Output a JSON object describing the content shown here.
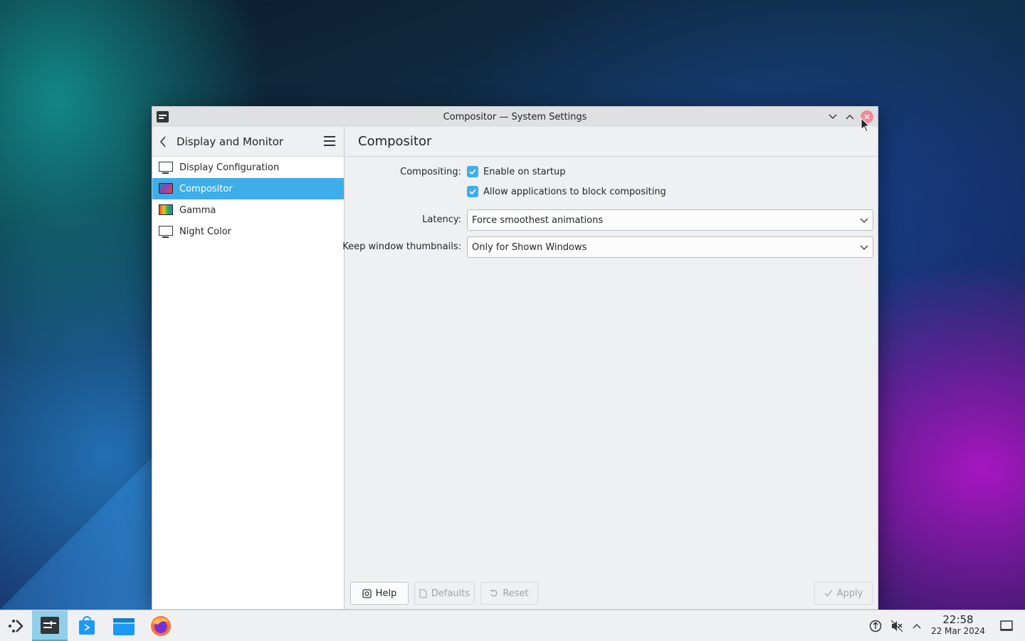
{
  "window": {
    "title": "Compositor — System Settings"
  },
  "sidebar": {
    "header": "Display and Monitor",
    "items": [
      {
        "label": "Display Configuration",
        "icon": "monitor-icon",
        "active": false
      },
      {
        "label": "Compositor",
        "icon": "compositor-icon",
        "active": true
      },
      {
        "label": "Gamma",
        "icon": "gamma-icon",
        "active": false
      },
      {
        "label": "Night Color",
        "icon": "monitor-icon",
        "active": false
      }
    ]
  },
  "main": {
    "title": "Compositor",
    "compositing_label": "Compositing:",
    "enable_on_startup": {
      "label": "Enable on startup",
      "checked": true
    },
    "allow_block": {
      "label": "Allow applications to block compositing",
      "checked": true
    },
    "latency_label": "Latency:",
    "latency_value": "Force smoothest animations",
    "thumbnails_label": "Keep window thumbnails:",
    "thumbnails_value": "Only for Shown Windows"
  },
  "buttons": {
    "help": "Help",
    "defaults": "Defaults",
    "reset": "Reset",
    "apply": "Apply"
  },
  "taskbar": {
    "time": "22:58",
    "date": "22 Mar 2024"
  },
  "colors": {
    "accent": "#3daee9",
    "window_bg": "#eff0f1",
    "close_button": "#ee8a99"
  }
}
